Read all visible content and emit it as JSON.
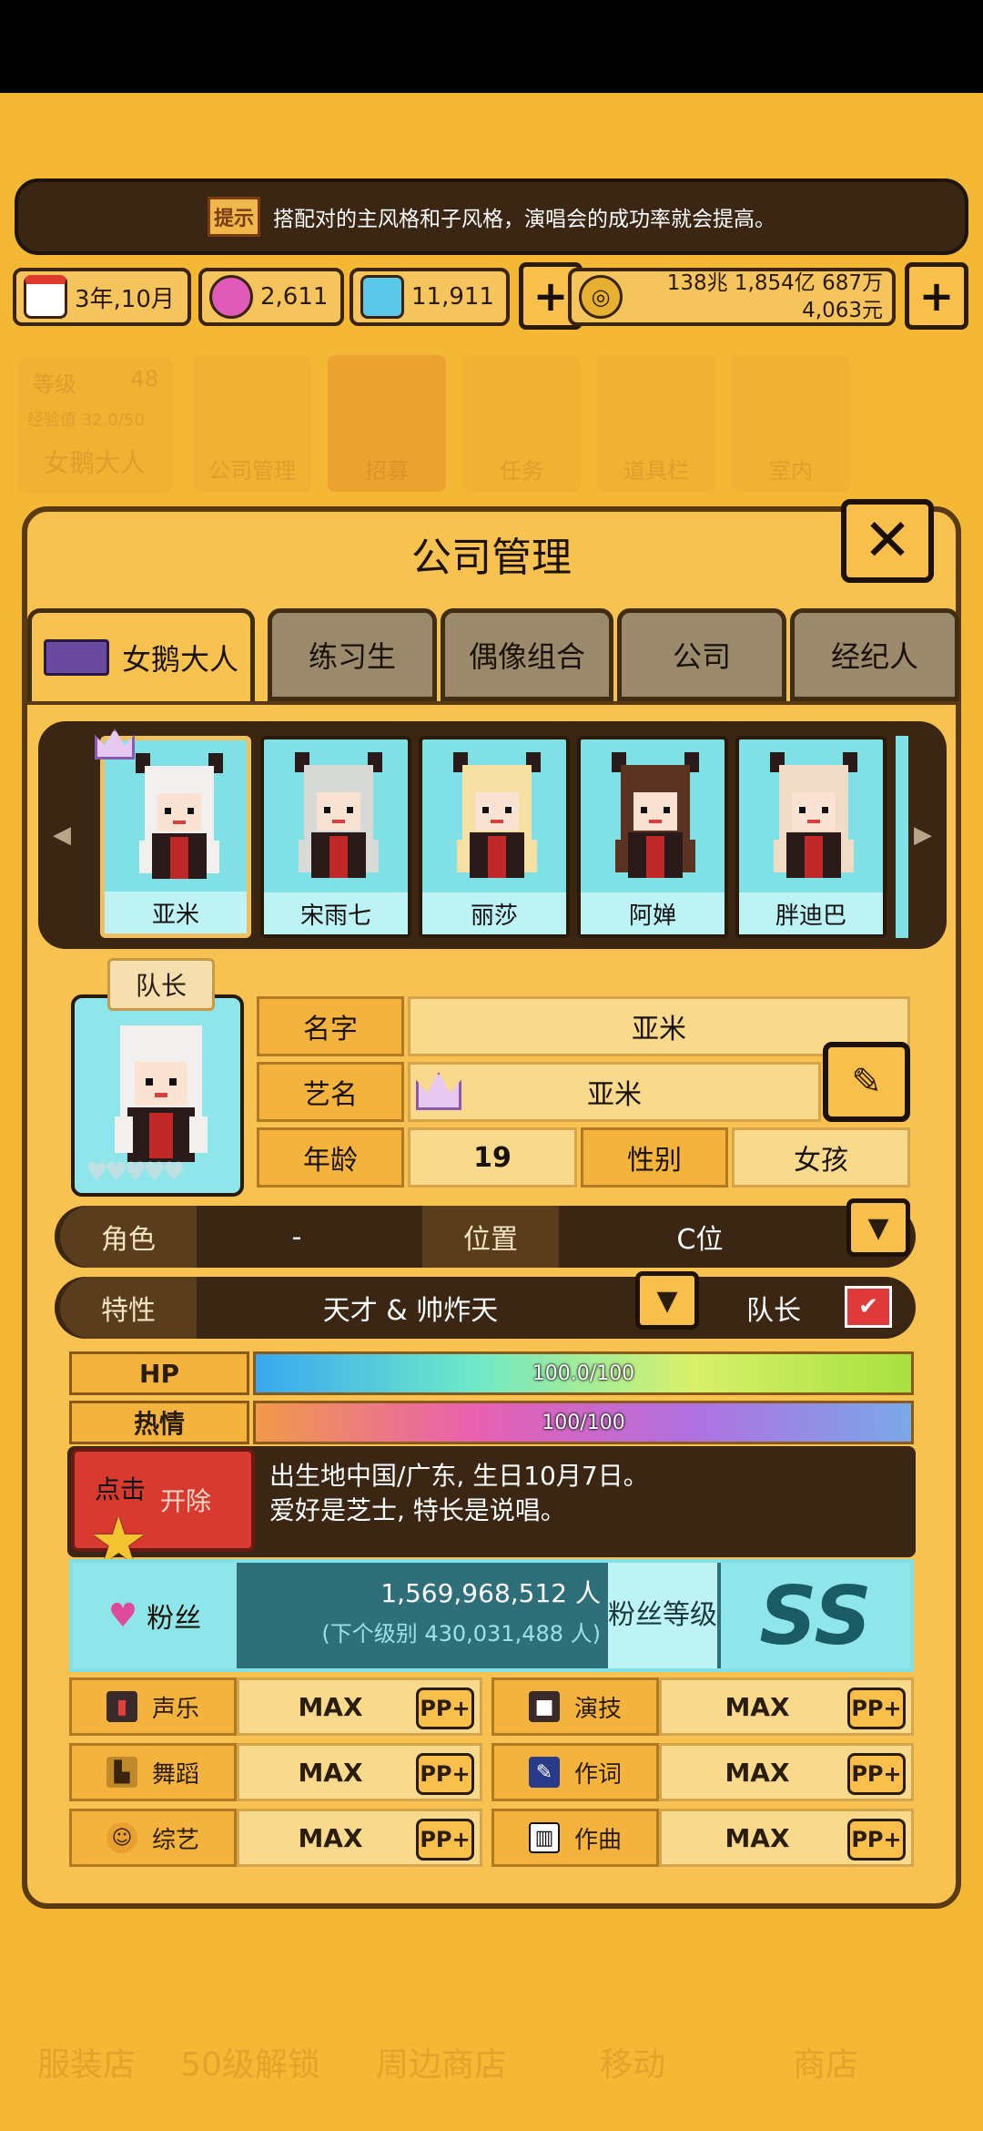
{
  "tip": {
    "icon_label": "提示",
    "text": "搭配对的主风格和子风格，演唱会的成功率就会提高。"
  },
  "resources": {
    "date": "3年,10月",
    "gems_pink": "2,611",
    "gems_blue": "11,911",
    "money_line1": "138兆 1,854亿 687万",
    "money_line2": "4,063元"
  },
  "background": {
    "level_label": "等级",
    "level_value": "48",
    "exp_label": "经验值 32.0/50",
    "player_name": "女鹅大人",
    "nav": [
      "公司管理",
      "招募",
      "任务",
      "道具栏",
      "室内"
    ],
    "shops": [
      "服装店",
      "50级解锁",
      "周边商店",
      "移动",
      "商店"
    ]
  },
  "modal": {
    "title": "公司管理",
    "tabs": [
      "女鹅大人",
      "练习生",
      "偶像组合",
      "公司",
      "经纪人"
    ]
  },
  "characters": [
    {
      "name": "亚米",
      "hair": "#f2f0ee"
    },
    {
      "name": "宋雨七",
      "hair": "#d8dad8"
    },
    {
      "name": "丽莎",
      "hair": "#f6e0a4"
    },
    {
      "name": "阿婵",
      "hair": "#5a3322"
    },
    {
      "name": "胖迪巴",
      "hair": "#f0dcc6"
    }
  ],
  "profile": {
    "captain_badge": "队长",
    "name_label": "名字",
    "name_value": "亚米",
    "stage_label": "艺名",
    "stage_value": "亚米",
    "age_label": "年龄",
    "age_value": "19",
    "gender_label": "性别",
    "gender_value": "女孩",
    "role_label": "角色",
    "role_value": "-",
    "position_label": "位置",
    "position_value": "C位",
    "trait_label": "特性",
    "trait_value": "天才 & 帅炸天",
    "leader_label": "队长"
  },
  "bars": {
    "hp_label": "HP",
    "hp_text": "100.0/100",
    "hp_fraction": 1.0,
    "passion_label": "热情",
    "passion_text": "100/100",
    "passion_fraction": 1.0
  },
  "tooltip": {
    "line1": "出生地中国/广东, 生日10月7日。",
    "line2": "爱好是芝士, 特长是说唱。",
    "remove_label": "开除",
    "click_label": "点击"
  },
  "fans": {
    "label": "粉丝",
    "count": "1,569,968,512 人",
    "next": "(下个级别 430,031,488 人)",
    "level_label": "粉丝等级",
    "level_value": "SS"
  },
  "skills": [
    {
      "name": "声乐",
      "value": "MAX",
      "pp": "PP+"
    },
    {
      "name": "演技",
      "value": "MAX",
      "pp": "PP+"
    },
    {
      "name": "舞蹈",
      "value": "MAX",
      "pp": "PP+"
    },
    {
      "name": "作词",
      "value": "MAX",
      "pp": "PP+"
    },
    {
      "name": "综艺",
      "value": "MAX",
      "pp": "PP+"
    },
    {
      "name": "作曲",
      "value": "MAX",
      "pp": "PP+"
    }
  ]
}
